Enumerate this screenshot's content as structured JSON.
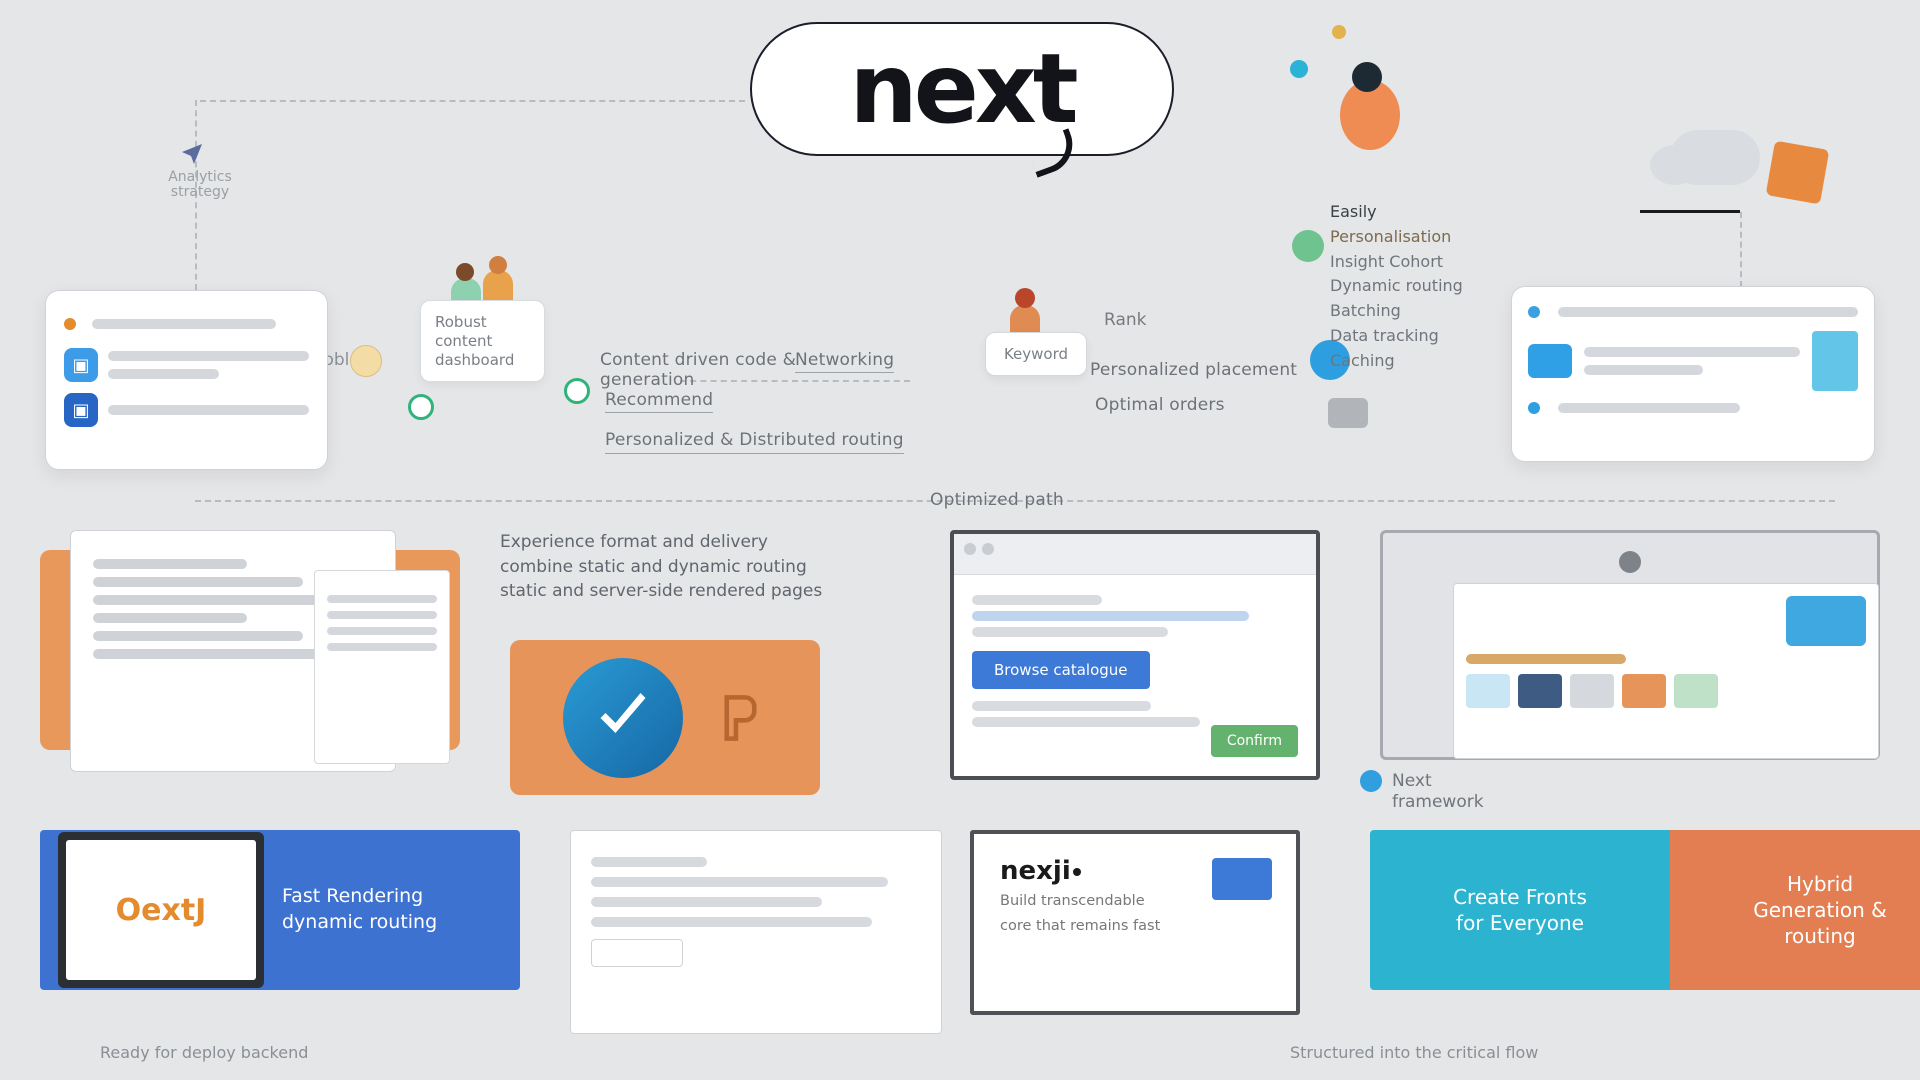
{
  "logo": "next",
  "topLeft": {
    "planeLabel": "Analytics strategy"
  },
  "tooltip": {
    "poole": "Robust content dashboard",
    "codeChip": "Dooble",
    "bubble": "Keyword",
    "bubbleSide": "Rank"
  },
  "midText": {
    "line1": "Content driven code & generation",
    "line2": "Networking",
    "line3": "Recommend",
    "line4": "Personalized & Distributed routing",
    "rightA": "Personalized placement",
    "rightB": "Optimal orders",
    "centre": "Optimized path"
  },
  "features": {
    "heading": "Easily",
    "sub": "Personalisation",
    "items": [
      "Insight Cohort",
      "Dynamic routing",
      "Batching",
      "Data tracking",
      "Caching"
    ]
  },
  "cardB": {
    "l1": "Experience format and delivery",
    "l2": "combine static and dynamic routing",
    "l3": "static and server-side rendered pages"
  },
  "cardC": {
    "btn": "Browse catalogue",
    "btn2": "Confirm"
  },
  "sideCap": {
    "title": "Next",
    "sub": "framework"
  },
  "bottom": {
    "a": {
      "logo": "OextJ",
      "l1": "Fast Rendering",
      "l2": "dynamic routing"
    },
    "c": {
      "logo": "nexji",
      "p1": "Build transcendable",
      "p2": "core that remains fast"
    },
    "d": {
      "l1": "Create Fronts",
      "l2": "for Everyone",
      "r1": "Hybrid",
      "r2": "Generation &",
      "r3": "routing"
    }
  },
  "foot1": "Ready for deploy backend",
  "foot2": "Structured into the critical flow"
}
